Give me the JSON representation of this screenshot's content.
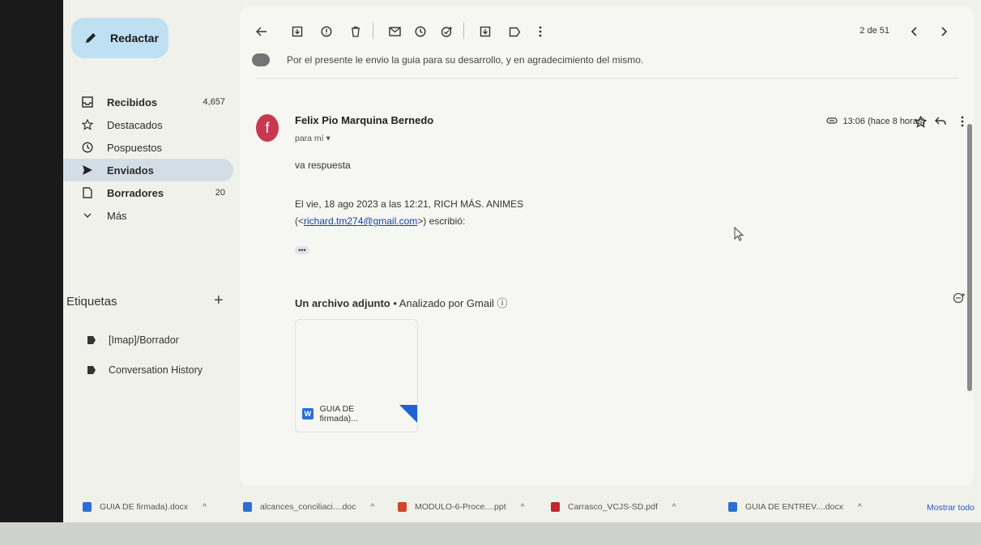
{
  "sidebar": {
    "compose_label": "Redactar",
    "items": [
      {
        "label": "Recibidos",
        "count": "4,657",
        "icon": "inbox-icon"
      },
      {
        "label": "Destacados",
        "count": "",
        "icon": "star-icon"
      },
      {
        "label": "Pospuestos",
        "count": "",
        "icon": "clock-icon"
      },
      {
        "label": "Enviados",
        "count": "",
        "icon": "send-icon"
      },
      {
        "label": "Borradores",
        "count": "20",
        "icon": "draft-icon"
      },
      {
        "label": "Más",
        "count": "",
        "icon": "chevron-down-icon"
      }
    ],
    "labels_title": "Etiquetas",
    "labels_add": "+",
    "labels": [
      "[Imap]/Borrador",
      "Conversation History"
    ]
  },
  "toolbar": {
    "pager": "2 de 51"
  },
  "previous_snippet": "Por el presente le envio la guia para su desarrollo, y en agradecimiento del mismo.",
  "message": {
    "avatar_letter": "f",
    "sender": "Felix Pio Marquina Bernedo",
    "to": "para mí ▾",
    "time": "13:06 (hace 8 horas)",
    "body": "va respuesta",
    "quote_line1": "El vie, 18 ago 2023 a las 12:21, RICH MÁS. ANIMES",
    "quote_prefix": "(<",
    "quote_email": "richard.tm274@gmail.com",
    "quote_suffix": ">) escribió:",
    "dots": "•••"
  },
  "attachments": {
    "title_bold": "Un archivo adjunto",
    "title_rest": " • Analizado por Gmail ⓘ",
    "file_label": "GUIA DE firmada)...",
    "file_icon_letter": "W"
  },
  "downloads": {
    "items": [
      {
        "name": "GUIA DE firmada).docx",
        "color": "#2b6fd6"
      },
      {
        "name": "alcances_conciliaci....doc",
        "color": "#2b6fd6"
      },
      {
        "name": "MODULO-6-Proce....ppt",
        "color": "#d2452a"
      },
      {
        "name": "Carrasco_VCJS-SD.pdf",
        "color": "#c0282e"
      },
      {
        "name": "GUIA DE ENTREV....docx",
        "color": "#2b6fd6"
      }
    ],
    "show_all": "Mostrar todo"
  }
}
